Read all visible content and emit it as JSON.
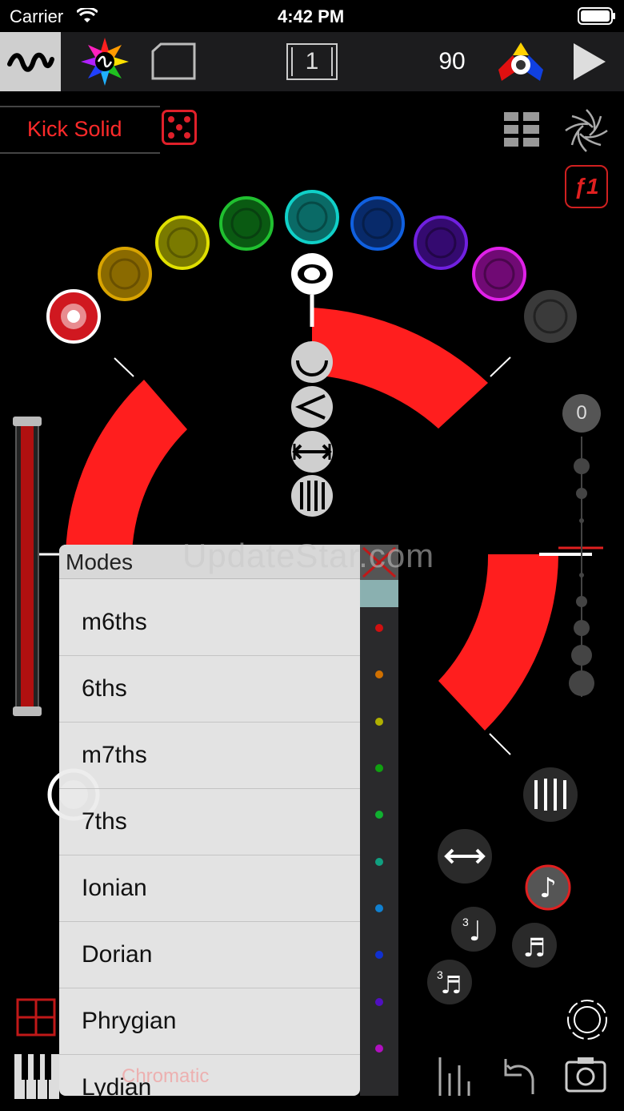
{
  "status_bar": {
    "carrier": "Carrier",
    "time": "4:42 PM"
  },
  "toolbar": {
    "pattern_number": "1",
    "tempo": "90"
  },
  "instrument": {
    "name": "Kick Solid"
  },
  "function_button": {
    "label": "ƒ1"
  },
  "octave_indicator": {
    "value": "0"
  },
  "modes_panel": {
    "title": "Modes",
    "items": [
      "m6ths",
      "6ths",
      "m7ths",
      "7ths",
      "Ionian",
      "Dorian",
      "Phrygian",
      "Lydian"
    ]
  },
  "scale_label": "Chromatic",
  "watermark": "UpdateStar.com",
  "colors": {
    "accent_red": "#ff1e1e",
    "note_circles": [
      "#d01820",
      "#c08a00",
      "#b4b400",
      "#10801a",
      "#0a9a90",
      "#0a3a9a",
      "#4a10a0",
      "#a010a8",
      "#3a3a3a"
    ],
    "strip_dots": [
      "#d01010",
      "#d07000",
      "#b0b000",
      "#10a010",
      "#10b030",
      "#10a080",
      "#1080d0",
      "#1030d0",
      "#5010c0",
      "#b010c0"
    ]
  }
}
